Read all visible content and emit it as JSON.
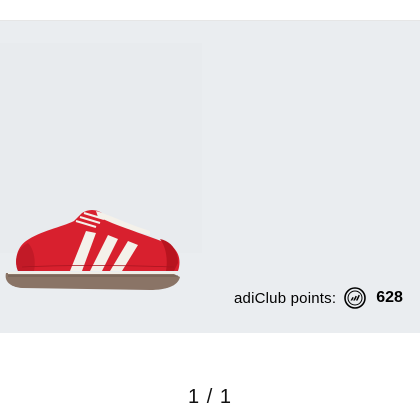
{
  "gallery": {
    "product_image": {
      "alt": "Red leather sneaker with white stripes and gum sole",
      "colors": {
        "upper": "#d8202e",
        "stripes": "#f4f1ea",
        "sole": "#8a7466",
        "background": "#eaedf0"
      }
    }
  },
  "adiclub": {
    "label": "adiClub points:",
    "icon": "adiclub-badge-icon",
    "value": "628"
  },
  "pager": {
    "text": "1 / 1"
  }
}
